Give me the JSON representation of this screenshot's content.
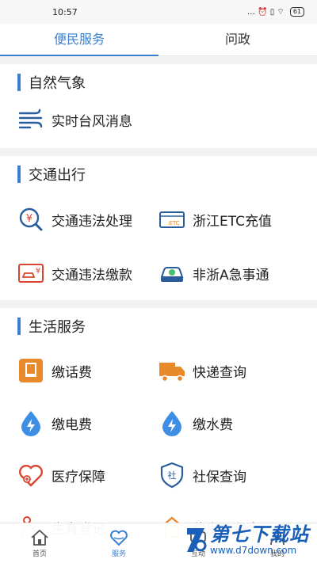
{
  "status_bar": {
    "time": "10:57",
    "icons": "… ⏰ ▯ ⌔",
    "battery": "61"
  },
  "tabs": [
    {
      "label": "便民服务",
      "active": true
    },
    {
      "label": "问政",
      "active": false
    }
  ],
  "sections": {
    "nature": {
      "title": "自然气象",
      "items": [
        {
          "label": "实时台风消息",
          "icon": "typhoon-wind-icon"
        }
      ]
    },
    "traffic": {
      "title": "交通出行",
      "items": [
        {
          "label": "交通违法处理",
          "icon": "traffic-violation-icon"
        },
        {
          "label": "浙江ETC充值",
          "icon": "etc-card-icon"
        },
        {
          "label": "交通违法缴款",
          "icon": "car-payment-icon"
        },
        {
          "label": "非浙A急事通",
          "icon": "car-urgent-icon"
        }
      ]
    },
    "life": {
      "title": "生活服务",
      "items": [
        {
          "label": "缴话费",
          "icon": "phone-bill-icon"
        },
        {
          "label": "快递查询",
          "icon": "delivery-truck-icon"
        },
        {
          "label": "缴电费",
          "icon": "electricity-drop-icon"
        },
        {
          "label": "缴水费",
          "icon": "water-drop-icon"
        },
        {
          "label": "医疗保障",
          "icon": "heart-medical-icon"
        },
        {
          "label": "社保查询",
          "icon": "social-security-shield-icon"
        },
        {
          "label": "生育登记",
          "icon": "birth-registration-icon"
        },
        {
          "label": "住房公积金",
          "icon": "housing-fund-icon"
        }
      ]
    }
  },
  "bottom_nav": [
    {
      "label": "首页",
      "icon": "home-icon",
      "active": false
    },
    {
      "label": "服务",
      "icon": "heart-service-icon",
      "active": true
    },
    {
      "label": "互动",
      "icon": "chat-icon",
      "active": false
    },
    {
      "label": "我的",
      "icon": "user-icon",
      "active": false
    }
  ],
  "watermark": {
    "title": "第七下载站",
    "url": "www.d7down.com"
  },
  "colors": {
    "accent": "#3a7fd0",
    "orange": "#e8892b",
    "red": "#d9452f",
    "blue_icon": "#3f8ee6"
  }
}
